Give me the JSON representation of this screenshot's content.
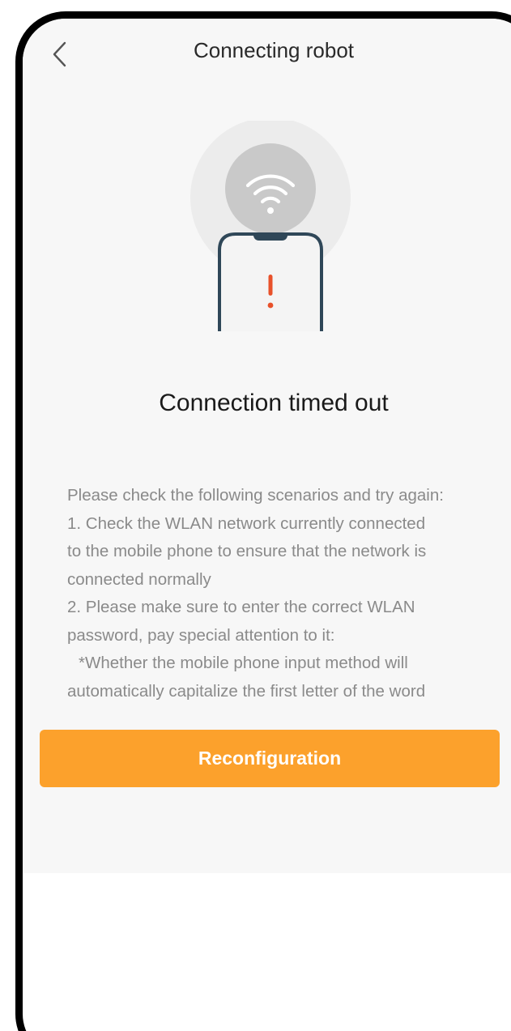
{
  "header": {
    "title": "Connecting robot",
    "back_icon": "chevron-left-icon"
  },
  "illustration": {
    "wifi_icon": "wifi-icon",
    "alert_icon": "exclamation-icon",
    "alert_color": "#e8512a"
  },
  "status": {
    "heading": "Connection timed out"
  },
  "tips": {
    "lines": [
      "Please check the following scenarios and try again:",
      "1. Check the WLAN network currently connected",
      "to the mobile phone to ensure that the network is",
      "connected normally",
      "2. Please make sure to enter the correct WLAN",
      "password, pay special attention to it:",
      "*Whether the mobile phone input method will",
      "automatically capitalize the first letter of the word"
    ]
  },
  "actions": {
    "reconfigure_label": "Reconfiguration",
    "accent_color": "#fca12c"
  }
}
